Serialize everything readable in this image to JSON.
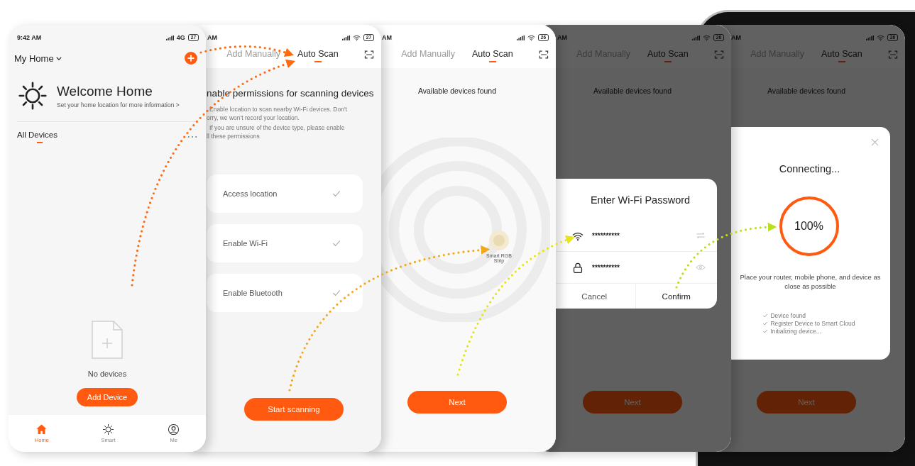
{
  "screens": [
    {
      "kind": "home",
      "dimmed": false,
      "status": {
        "time": "9:42 AM",
        "network": "4G",
        "wifi": false,
        "battery": "27"
      },
      "home_menu": "My Home",
      "welcome": {
        "title": "Welcome Home",
        "subtitle": "Set your home location for more information >"
      },
      "section": "All Devices",
      "empty_text": "No devices",
      "button": "Add Device",
      "nav": [
        {
          "label": "Home",
          "selected": true
        },
        {
          "label": "Smart",
          "selected": false
        },
        {
          "label": "Me",
          "selected": false
        }
      ]
    },
    {
      "kind": "permissions",
      "dimmed": false,
      "status": {
        "time": "AM",
        "wifi": true,
        "battery": "27"
      },
      "tabs": [
        {
          "label": "Add Manually",
          "selected": false
        },
        {
          "label": "Auto Scan",
          "selected": true
        }
      ],
      "heading": "nable permissions for scanning devices",
      "notes": [
        "Enable location to scan nearby Wi-Fi devices. Don't",
        "orry, we won't record your location.",
        "If you are unsure of the device type, please enable",
        "ll these permissions"
      ],
      "permissions": [
        {
          "label": "Access location",
          "checked": true
        },
        {
          "label": "Enable Wi-Fi",
          "checked": true
        },
        {
          "label": "Enable Bluetooth",
          "checked": true
        }
      ],
      "button": "Start scanning"
    },
    {
      "kind": "scan",
      "dimmed": false,
      "status": {
        "time": "AM",
        "wifi": true,
        "battery": "26"
      },
      "tabs": [
        {
          "label": "Add Manually",
          "selected": false
        },
        {
          "label": "Auto Scan",
          "selected": true
        }
      ],
      "caption": "Available devices found",
      "device": "Smart RGB Strip",
      "button": "Next"
    },
    {
      "kind": "scan",
      "dimmed": true,
      "status": {
        "time": "AM",
        "wifi": true,
        "battery": "26"
      },
      "tabs": [
        {
          "label": "Add Manually",
          "selected": false
        },
        {
          "label": "Auto Scan",
          "selected": true
        }
      ],
      "caption": "Available devices found",
      "button": "Next",
      "dialog": {
        "kind": "password",
        "title": "Enter Wi-Fi Password",
        "fields": [
          {
            "kind": "network",
            "value": "**********"
          },
          {
            "kind": "password",
            "value": "**********"
          }
        ],
        "buttons": [
          "Cancel",
          "Confirm"
        ]
      }
    },
    {
      "kind": "scan",
      "dimmed": true,
      "status": {
        "time": "AM",
        "wifi": true,
        "battery": "26"
      },
      "tabs": [
        {
          "label": "Add Manually",
          "selected": false
        },
        {
          "label": "Auto Scan",
          "selected": true
        }
      ],
      "caption": "Available devices found",
      "button": "Next",
      "dialog": {
        "kind": "connecting",
        "title": "Connecting...",
        "level": 1,
        "percent": "100%",
        "hint": "Place your router, mobile phone, and device as close as possible",
        "steps": [
          {
            "label": "Device found",
            "checked": true
          },
          {
            "label": "Register Device to Smart Cloud",
            "checked": true
          },
          {
            "label": "Initializing device...",
            "checked": true
          }
        ]
      }
    }
  ]
}
